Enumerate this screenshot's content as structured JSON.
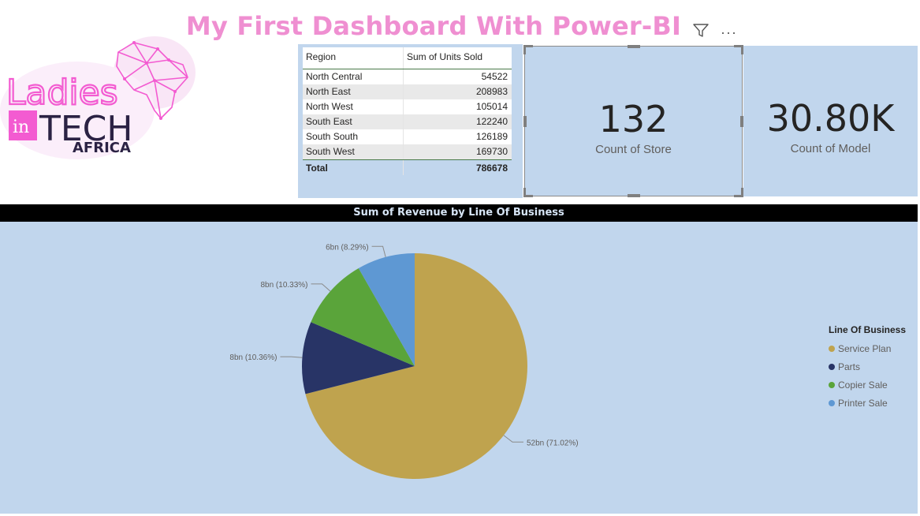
{
  "header": {
    "title": "My First Dashboard With Power-BI",
    "filter_icon": "filter-icon",
    "more_icon": "more-options-icon",
    "more_glyph": "···"
  },
  "logo": {
    "line1": "Ladies",
    "badge": "in",
    "line2": "TECH",
    "line3": "AFRICA",
    "colors": {
      "pink": "#f35bd1",
      "dark": "#2b2244",
      "glow": "#f7d8f2"
    }
  },
  "table": {
    "headers": [
      "Region",
      "Sum of Units Sold"
    ],
    "rows": [
      {
        "region": "North Central",
        "units": "54522"
      },
      {
        "region": "North East",
        "units": "208983"
      },
      {
        "region": "North West",
        "units": "105014"
      },
      {
        "region": "South East",
        "units": "122240"
      },
      {
        "region": "South South",
        "units": "126189"
      },
      {
        "region": "South West",
        "units": "169730"
      }
    ],
    "total_label": "Total",
    "total_value": "786678"
  },
  "kpis": {
    "store": {
      "value": "132",
      "label": "Count of Store"
    },
    "model": {
      "value": "30.80K",
      "label": "Count of Model"
    }
  },
  "colors": {
    "card_bg": "#c1d6ed",
    "title_pink": "#ef8fd1"
  },
  "chart_data": {
    "type": "pie",
    "title": "Sum of Revenue by Line Of Business",
    "legend_title": "Line Of Business",
    "legend_position": "right",
    "slices": [
      {
        "name": "Service Plan",
        "percent": 71.02,
        "label": "52bn (71.02%)",
        "color": "#bfa34e"
      },
      {
        "name": "Parts",
        "percent": 10.36,
        "label": "8bn (10.36%)",
        "color": "#283466"
      },
      {
        "name": "Copier Sale",
        "percent": 10.33,
        "label": "8bn (10.33%)",
        "color": "#5aa43a"
      },
      {
        "name": "Printer Sale",
        "percent": 8.29,
        "label": "6bn (8.29%)",
        "color": "#5e98d3"
      }
    ]
  }
}
